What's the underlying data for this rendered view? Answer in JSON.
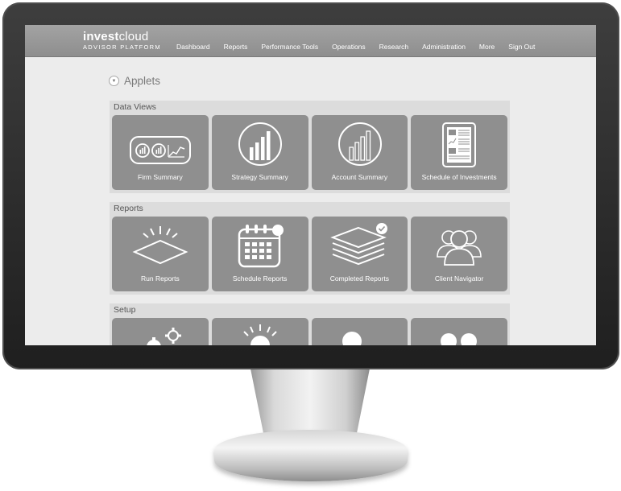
{
  "header": {
    "brand_bold": "invest",
    "brand_light": "cloud",
    "brand_sub": "ADVISOR PLATFORM",
    "nav": [
      "Dashboard",
      "Reports",
      "Performance Tools",
      "Operations",
      "Research",
      "Administration",
      "More",
      "Sign Out"
    ]
  },
  "applets": {
    "title": "Applets",
    "toggle_icon": "chevron-down-icon"
  },
  "sections": [
    {
      "title": "Data Views",
      "tiles": [
        {
          "label": "Firm Summary",
          "icon": "firm-summary-icon"
        },
        {
          "label": "Strategy Summary",
          "icon": "strategy-chart-icon"
        },
        {
          "label": "Account Summary",
          "icon": "account-chart-icon"
        },
        {
          "label": "Schedule of Investments",
          "icon": "document-icon"
        }
      ]
    },
    {
      "title": "Reports",
      "tiles": [
        {
          "label": "Run Reports",
          "icon": "run-reports-icon"
        },
        {
          "label": "Schedule Reports",
          "icon": "calendar-icon"
        },
        {
          "label": "Completed Reports",
          "icon": "layers-check-icon"
        },
        {
          "label": "Client Navigator",
          "icon": "users-group-icon"
        }
      ]
    },
    {
      "title": "Setup",
      "tiles": [
        {
          "label": "",
          "icon": "gears-icon"
        },
        {
          "label": "",
          "icon": "sun-icon"
        },
        {
          "label": "",
          "icon": "user-icon"
        },
        {
          "label": "",
          "icon": "users-icon"
        }
      ]
    }
  ]
}
